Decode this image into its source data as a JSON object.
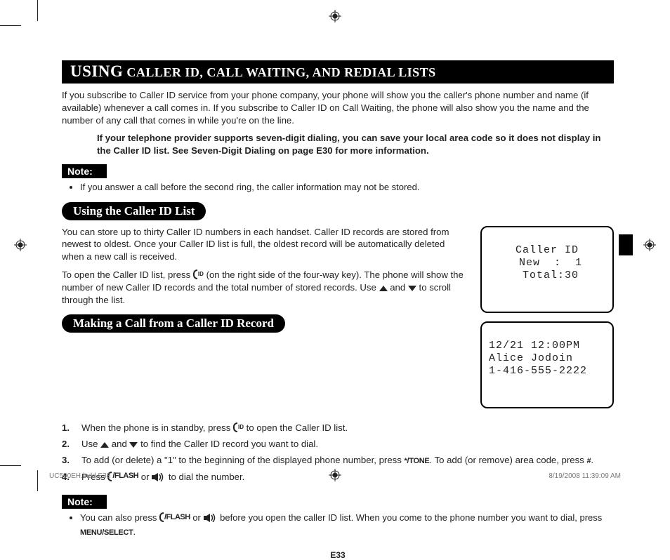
{
  "title": {
    "big": "USING",
    "rest": " CALLER ID, CALL WAITING, AND REDIAL LISTS"
  },
  "intro": "If you subscribe to Caller ID service from your phone company, your phone will show you the caller's phone number and name (if available) whenever a call comes in. If you subscribe to Caller ID on Call Waiting, the phone will also show you the name and the number of any call that comes in while you're on the line.",
  "intro_bold": "If your telephone provider supports seven-digit dialing, you can save your local area code so it does not display in the Caller ID list. See Seven-Digit Dialing on page E30 for more information.",
  "note1_label": "Note:",
  "note1_item": "If you answer a call before the second ring, the caller information may not be stored.",
  "sec1_heading": "Using the Caller ID List",
  "sec1_p1": "You can store up to thirty Caller ID numbers in each handset. Caller ID records are stored from newest to oldest. Once your Caller ID list is full, the oldest record will be automatically deleted when a new call is received.",
  "sec1_p2a": "To open the Caller ID list, press ",
  "sec1_p2b": " (on the right side of the four-way key). The phone will show the number of new Caller ID records and the total number of stored records. Use ",
  "sec1_p2c": " and ",
  "sec1_p2d": " to scroll through the list.",
  "lcd1": {
    "l1": "Caller ID",
    "l2": " New  :  1",
    "l3": " Total:30"
  },
  "lcd2": {
    "l1": "12/21 12:00PM",
    "l2": "Alice Jodoin",
    "l3": "1-416-555-2222"
  },
  "sec2_heading": "Making a Call from a Caller ID Record",
  "steps": {
    "s1a": "When the phone is in standby, press ",
    "s1b": " to open the Caller ID list.",
    "s2a": "Use ",
    "s2b": " and ",
    "s2c": " to find the Caller ID record you want to dial.",
    "s3a": "To add (or delete) a \"1\" to the beginning of the displayed phone number, press ",
    "s3key": "*/TONE",
    "s3b": ". To add (or remove) area code, press ",
    "s3key2": "#",
    "s3c": ".",
    "s4a": "Press ",
    "s4flash": "/FLASH",
    "s4b": " or ",
    "s4c": " to dial the number."
  },
  "note2_label": "Note:",
  "note2_a": "You can also press ",
  "note2_flash": "/FLASH",
  "note2_b": " or ",
  "note2_c": " before you open the caller ID list. When you come to the phone number you want to dial, press ",
  "note2_key": "MENU/SELECT",
  "note2_d": ".",
  "page_num": "E33",
  "footer": {
    "left": "UC590EH.indd   E33",
    "right": "8/19/2008   11:39:09 AM"
  }
}
